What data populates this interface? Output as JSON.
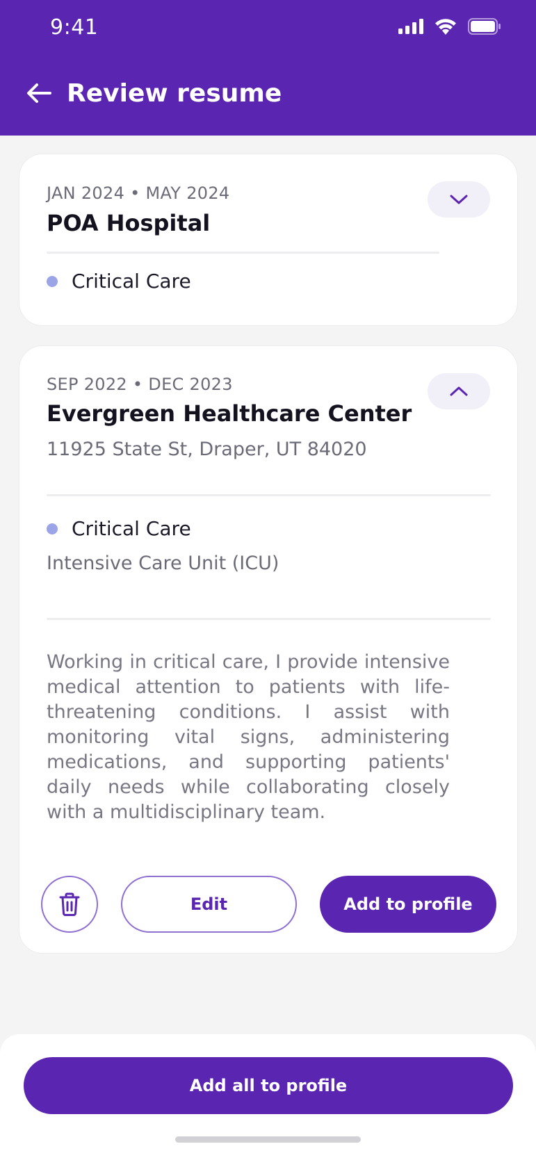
{
  "status_bar": {
    "time": "9:41"
  },
  "header": {
    "title": "Review resume"
  },
  "entries": [
    {
      "dates": "JAN 2024 • MAY 2024",
      "company": "POA Hospital",
      "specialty": "Critical Care"
    },
    {
      "dates": "SEP 2022 • DEC 2023",
      "company": "Evergreen Healthcare Center",
      "address": "11925 State St, Draper, UT 84020",
      "specialty": "Critical Care",
      "unit": "Intensive Care Unit (ICU)",
      "description": "Working in critical care, I provide intensive medical attention to patients with life-threatening conditions. I assist with monitoring vital signs, administering medications, and supporting patients' daily needs while collaborating closely with a multidisciplinary team.",
      "edit_label": "Edit",
      "add_label": "Add to profile"
    }
  ],
  "footer": {
    "add_all_label": "Add all to profile"
  },
  "colors": {
    "primary": "#5a25b0",
    "dot": "#9ba4e6",
    "background": "#f4f4f5"
  },
  "icons": [
    "back-arrow-icon",
    "signal-icon",
    "wifi-icon",
    "battery-icon",
    "chevron-down-icon",
    "chevron-up-icon",
    "trash-icon"
  ]
}
